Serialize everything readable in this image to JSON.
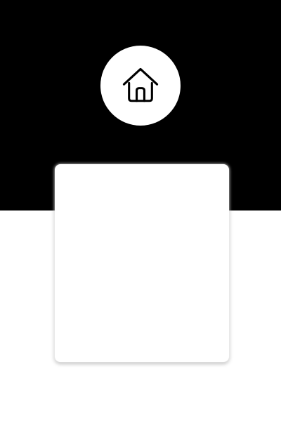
{
  "theme": {
    "top_background": "#000000",
    "bottom_background": "#ffffff",
    "badge_background": "#ffffff",
    "icon_stroke": "#000000",
    "card_background": "#ffffff"
  },
  "header": {
    "icon": "home-icon"
  },
  "card": {}
}
